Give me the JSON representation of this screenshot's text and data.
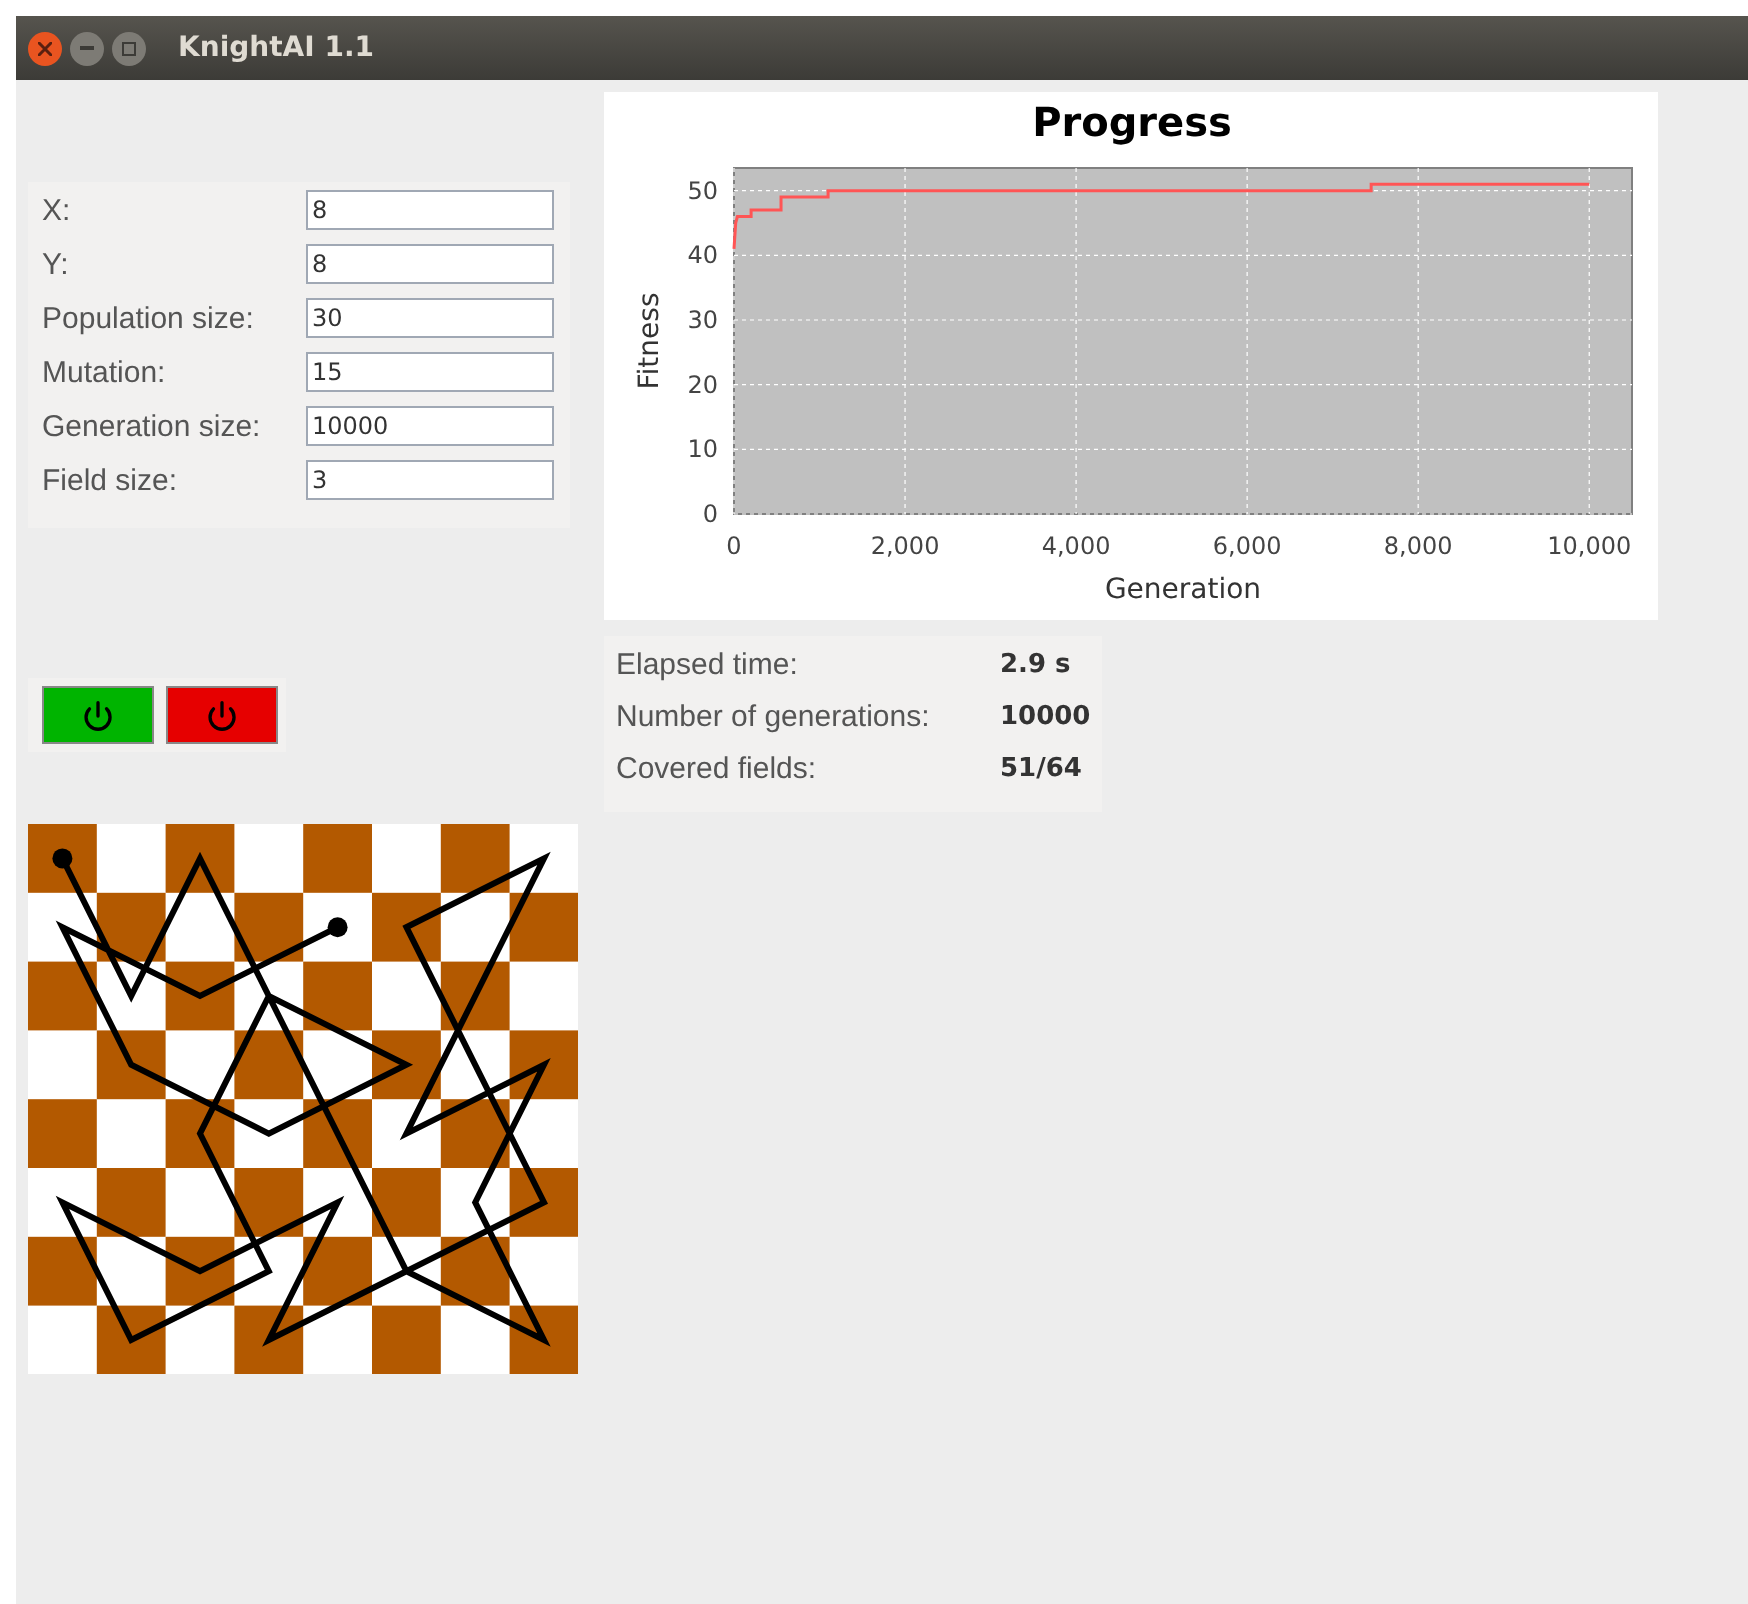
{
  "window": {
    "title": "KnightAI 1.1"
  },
  "settings": [
    {
      "label": "X:",
      "value": "8"
    },
    {
      "label": "Y:",
      "value": "8"
    },
    {
      "label": "Population size:",
      "value": "30"
    },
    {
      "label": "Mutation:",
      "value": "15"
    },
    {
      "label": "Generation size:",
      "value": "10000"
    },
    {
      "label": "Field size:",
      "value": "3"
    }
  ],
  "buttons": [
    {
      "color": "#00b400"
    },
    {
      "color": "#e60000"
    }
  ],
  "chart": {
    "chart_data": {
      "type": "line",
      "title": "Progress",
      "xlabel": "Generation",
      "ylabel": "Fitness",
      "x": [
        0,
        20,
        40,
        200,
        200,
        550,
        550,
        1100,
        1100,
        7450,
        7450,
        10000
      ],
      "grid": true,
      "series": [
        {
          "color": "#ff5555",
          "values": [
            41,
            45,
            46,
            46,
            47,
            47,
            49,
            49,
            50,
            50,
            51,
            51
          ]
        }
      ],
      "xlim": [
        0,
        10500
      ],
      "ylim": [
        0,
        53.5
      ],
      "xticks": [
        {
          "value": 0,
          "label": "0"
        },
        {
          "value": 2000,
          "label": "2,000"
        },
        {
          "value": 4000,
          "label": "4,000"
        },
        {
          "value": 6000,
          "label": "6,000"
        },
        {
          "value": 8000,
          "label": "8,000"
        },
        {
          "value": 10000,
          "label": "10,000"
        }
      ],
      "yticks": [
        0,
        10,
        20,
        30,
        40,
        50
      ]
    }
  },
  "stats": [
    {
      "label": "Elapsed time:",
      "value": "2.9 s"
    },
    {
      "label": "Number of generations:",
      "value": "10000"
    },
    {
      "label": "Covered fields:",
      "value": "51/64"
    }
  ]
}
